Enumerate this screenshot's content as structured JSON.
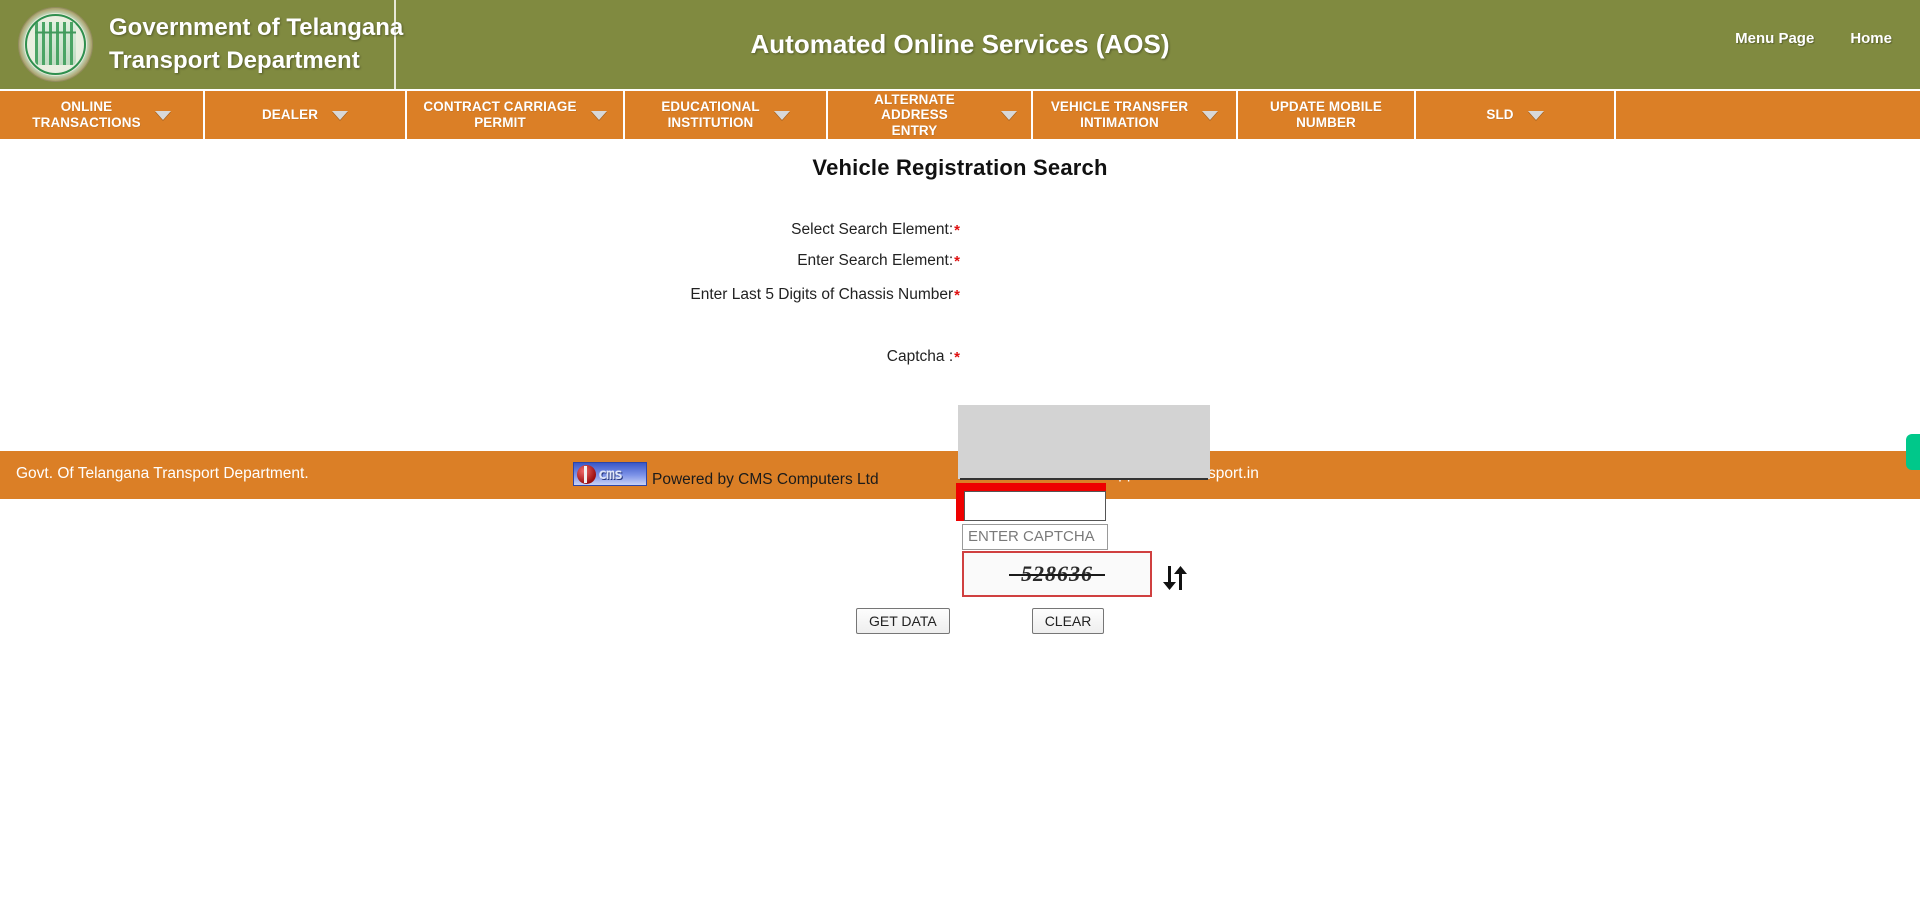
{
  "colors": {
    "header_green": "#808a40",
    "nav_orange": "#db7f26",
    "required_red": "#e01010",
    "highlight_red": "#ee0000",
    "accent_green_marker": "#00c88a"
  },
  "header": {
    "emblem_icon": "telangana-government-emblem-icon",
    "brand_line1": "Government of Telangana",
    "brand_line2": "Transport Department",
    "title": "Automated Online Services (AOS)",
    "links": [
      {
        "label": "Menu Page",
        "name": "menu-page-link"
      },
      {
        "label": "Home",
        "name": "home-link"
      }
    ]
  },
  "nav": {
    "items": [
      {
        "label": "ONLINE TRANSACTIONS",
        "line1": "ONLINE",
        "line2": "TRANSACTIONS",
        "has_caret": true
      },
      {
        "label": "DEALER",
        "line1": "DEALER",
        "line2": "",
        "has_caret": true
      },
      {
        "label": "CONTRACT CARRIAGE PERMIT",
        "line1": "CONTRACT CARRIAGE",
        "line2": "PERMIT",
        "has_caret": true
      },
      {
        "label": "EDUCATIONAL INSTITUTION",
        "line1": "EDUCATIONAL",
        "line2": "INSTITUTION",
        "has_caret": true
      },
      {
        "label": "ALTERNATE ADDRESS ENTRY",
        "line1": "ALTERNATE ADDRESS",
        "line2": "ENTRY",
        "has_caret": true
      },
      {
        "label": "VEHICLE TRANSFER INTIMATION",
        "line1": "VEHICLE TRANSFER",
        "line2": "INTIMATION",
        "has_caret": true
      },
      {
        "label": "UPDATE MOBILE NUMBER",
        "line1": "UPDATE MOBILE",
        "line2": "NUMBER",
        "has_caret": false
      },
      {
        "label": "SLD",
        "line1": "SLD",
        "line2": "",
        "has_caret": true
      }
    ]
  },
  "main": {
    "page_title": "Vehicle Registration Search",
    "required_mark": "*",
    "fields": {
      "select_search_element": {
        "label": "Select Search Element:",
        "value": "",
        "dropdown_open": true,
        "options": []
      },
      "enter_search_element": {
        "label": "Enter Search Element:",
        "value": ""
      },
      "chassis": {
        "label": "Enter Last 5 Digits of Chassis Number",
        "value": "",
        "highlighted": true
      },
      "captcha_entry": {
        "placeholder": "ENTER CAPTCHA",
        "value": ""
      },
      "captcha": {
        "label": "Captcha :",
        "image_text": "528636",
        "refresh_icon": "refresh-arrows-icon"
      }
    },
    "buttons": {
      "get_data": "GET DATA",
      "clear": "CLEAR"
    }
  },
  "footer": {
    "left_text": "Govt. Of Telangana Transport Department.",
    "cms_logo_label": "cms",
    "powered_by": "Powered by CMS Computers Ltd",
    "email": "E-Mail : support@tstransport.in"
  }
}
